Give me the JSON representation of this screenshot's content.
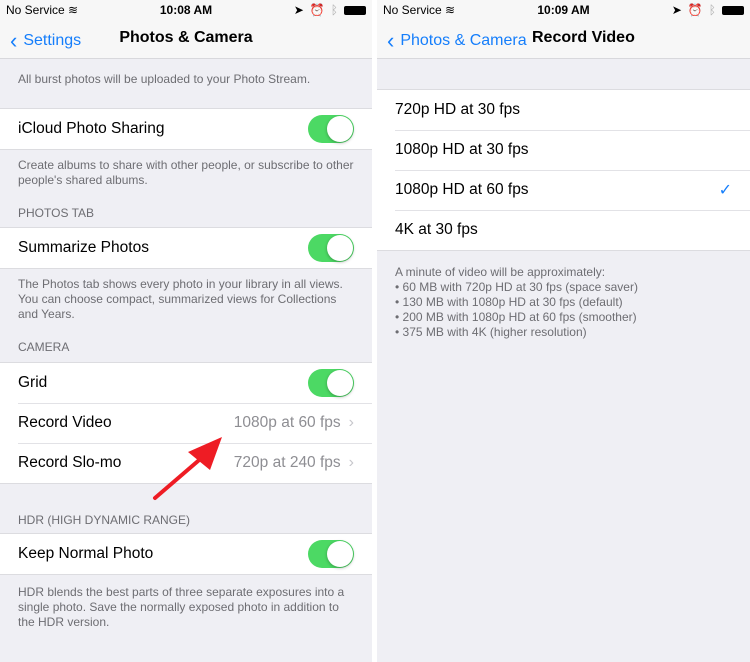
{
  "left": {
    "status": {
      "carrier": "No Service",
      "time": "10:08 AM"
    },
    "nav": {
      "back": "Settings",
      "title": "Photos & Camera"
    },
    "burst_footer": "All burst photos will be uploaded to your Photo Stream.",
    "icloud": {
      "label": "iCloud Photo Sharing",
      "on": true,
      "footer": "Create albums to share with other people, or subscribe to other people's shared albums."
    },
    "photos_tab": {
      "header": "PHOTOS TAB",
      "label": "Summarize Photos",
      "on": true,
      "footer": "The Photos tab shows every photo in your library in all views. You can choose compact, summarized views for Collections and Years."
    },
    "camera": {
      "header": "CAMERA",
      "grid": "Grid",
      "grid_on": true,
      "record_video": "Record Video",
      "record_video_value": "1080p at 60 fps",
      "slomo": "Record Slo-mo",
      "slomo_value": "720p at 240 fps"
    },
    "hdr": {
      "header": "HDR (HIGH DYNAMIC RANGE)",
      "label": "Keep Normal Photo",
      "on": true,
      "footer": "HDR blends the best parts of three separate exposures into a single photo. Save the normally exposed photo in addition to the HDR version."
    }
  },
  "right": {
    "status": {
      "carrier": "No Service",
      "time": "10:09 AM"
    },
    "nav": {
      "back": "Photos & Camera",
      "title": "Record Video"
    },
    "options": [
      {
        "label": "720p HD at 30 fps",
        "selected": false
      },
      {
        "label": "1080p HD at 30 fps",
        "selected": false
      },
      {
        "label": "1080p HD at 60 fps",
        "selected": true
      },
      {
        "label": "4K at 30 fps",
        "selected": false
      }
    ],
    "check_glyph": "✓",
    "footer": {
      "intro": "A minute of video will be approximately:",
      "lines": [
        "• 60 MB with 720p HD at 30 fps (space saver)",
        "• 130 MB with 1080p HD at 30 fps (default)",
        "• 200 MB with 1080p HD at 60 fps (smoother)",
        "• 375 MB with 4K (higher resolution)"
      ]
    }
  },
  "colors": {
    "accent": "#157efb",
    "toggle_on": "#4cd964",
    "annotation_arrow": "#ee1c24"
  }
}
